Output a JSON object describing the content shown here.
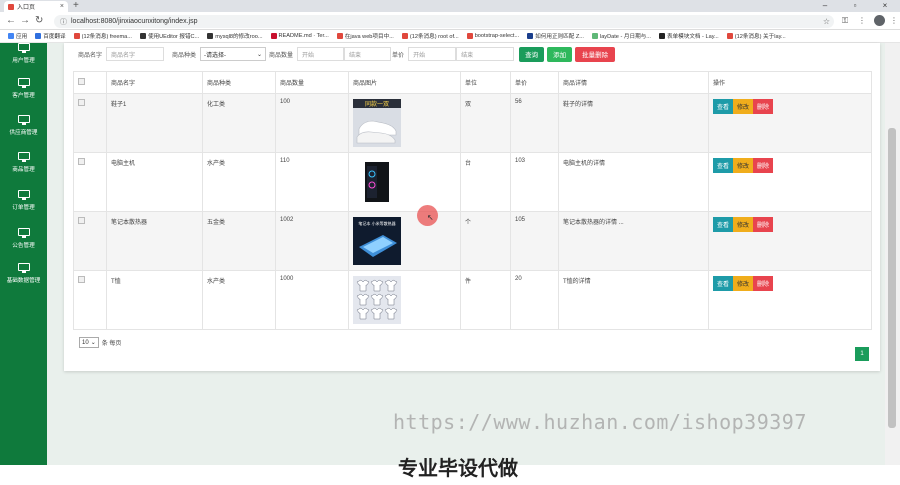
{
  "browser": {
    "tab_title": "入口页",
    "url": "localhost:8080/jinxiaocunxitong/index.jsp",
    "bookmarks": [
      {
        "label": "应用",
        "color": "#4285f4"
      },
      {
        "label": "百度翻译",
        "color": "#2f6fde"
      },
      {
        "label": "(12条消息) freema...",
        "color": "#e0483d"
      },
      {
        "label": "使用UEditor 报错C...",
        "color": "#333333"
      },
      {
        "label": "mysql8的修改roo...",
        "color": "#333333"
      },
      {
        "label": "README.md · Ter...",
        "color": "#c8102e"
      },
      {
        "label": "在java web项目中...",
        "color": "#e0483d"
      },
      {
        "label": "(12条消息) root of...",
        "color": "#e0483d"
      },
      {
        "label": "bootstrap-select...",
        "color": "#e0483d"
      },
      {
        "label": "如何用正则匹配 Z...",
        "color": "#1a3e8c"
      },
      {
        "label": "layDate - 月日期与...",
        "color": "#5fb878"
      },
      {
        "label": "表单模块文档 - Lay...",
        "color": "#222222"
      },
      {
        "label": "(12条消息) 关于lay...",
        "color": "#e0483d"
      }
    ]
  },
  "sidebar": {
    "items": [
      {
        "label": "用户管理"
      },
      {
        "label": "客户管理"
      },
      {
        "label": "供应商管理"
      },
      {
        "label": "商品管理"
      },
      {
        "label": "订单管理"
      },
      {
        "label": "公告管理"
      },
      {
        "label": "基础数据管理"
      }
    ]
  },
  "search": {
    "name_label": "商品名字",
    "name_placeholder": "商品名字",
    "type_label": "商品种类",
    "type_value": "-请选择-",
    "qty_label": "商品数量",
    "qty_start_placeholder": "开始",
    "qty_end_placeholder": "结束",
    "price_label": "单价",
    "price_start_placeholder": "开始",
    "price_end_placeholder": "结束",
    "query_button": "查询",
    "add_button": "添加",
    "batch_delete_button": "批量删除"
  },
  "table": {
    "headers": [
      "商品名字",
      "商品种类",
      "商品数量",
      "商品图片",
      "单位",
      "单价",
      "商品详情",
      "操作"
    ],
    "rows": [
      {
        "name": "鞋子1",
        "type": "化工类",
        "qty": "100",
        "image": "shoe-image",
        "unit": "双",
        "price": "56",
        "detail": "鞋子的详情"
      },
      {
        "name": "电脑主机",
        "type": "水产类",
        "qty": "110",
        "image": "computer-tower-image",
        "unit": "台",
        "price": "103",
        "detail": "电脑主机的详情"
      },
      {
        "name": "笔记本散热器",
        "type": "五金类",
        "qty": "1002",
        "image": "laptop-cooler-image",
        "unit": "个",
        "price": "105",
        "detail": "笔记本散热器的详情 ..."
      },
      {
        "name": "T恤",
        "type": "水产类",
        "qty": "1000",
        "image": "tshirt-image",
        "unit": "件",
        "price": "20",
        "detail": "T恤的详情"
      }
    ],
    "op_view": "查看",
    "op_edit": "修改",
    "op_delete": "删除",
    "image_texts": {
      "shoe": "同款一双",
      "cooler": "笔记本 小米等散热器"
    }
  },
  "pager": {
    "page_size": "10",
    "page_size_suffix": "条 每页",
    "current_page": "1"
  },
  "watermark": {
    "url": "https://www.huzhan.com/ishop39397",
    "slogan": "专业毕设代做"
  },
  "colors": {
    "sidebar": "#0f7a3c",
    "query": "#1a9c5b",
    "add": "#2eb85c",
    "batch_delete": "#e8444e",
    "view": "#1e9ba8",
    "edit": "#f0ad1c",
    "delete": "#e8444e"
  }
}
